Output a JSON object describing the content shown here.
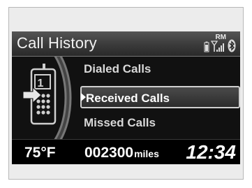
{
  "header": {
    "title": "Call History",
    "roaming_label": "RM"
  },
  "status_icons": [
    "phone-battery-icon",
    "signal-strength-icon",
    "bluetooth-icon"
  ],
  "menu": {
    "items": [
      {
        "label": "Dialed Calls",
        "selected": false
      },
      {
        "label": "Received Calls",
        "selected": true
      },
      {
        "label": "Missed Calls",
        "selected": false
      }
    ]
  },
  "phone_icon": {
    "line_number": "1"
  },
  "footer": {
    "temperature": "75°F",
    "odometer_value": "002300",
    "odometer_unit": "miles",
    "clock": "12:34"
  }
}
